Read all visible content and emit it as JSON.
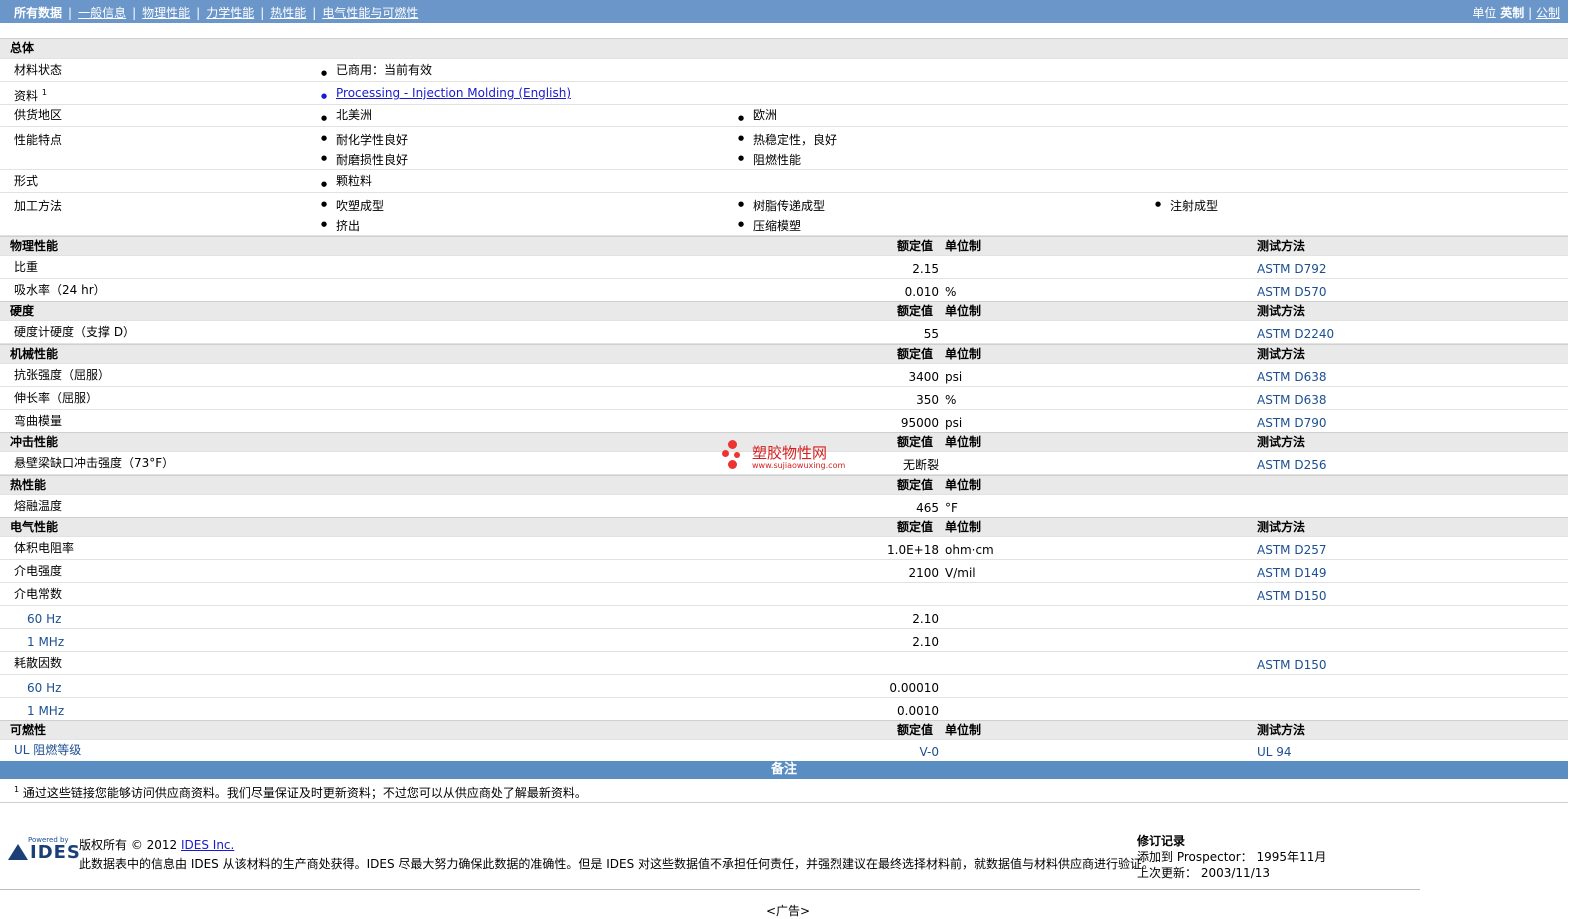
{
  "topnav": {
    "items": [
      "所有数据",
      "一般信息",
      "物理性能",
      "力学性能",
      "热性能",
      "电气性能与可燃性"
    ],
    "units_label": "单位",
    "unit_imperial": "英制",
    "unit_metric": "公制"
  },
  "general": {
    "title": "总体",
    "status_label": "材料状态",
    "status_value": "已商用：当前有效",
    "docs_label": "资料",
    "docs_sup": "1",
    "docs_link": "Processing - Injection Molding (English)",
    "region_label": "供货地区",
    "regions": [
      "北美洲",
      "欧洲"
    ],
    "features_label": "性能特点",
    "features": [
      "耐化学性良好",
      "热稳定性，良好",
      "耐磨损性良好",
      "阻燃性能"
    ],
    "form_label": "形式",
    "form_value": "颗粒料",
    "process_label": "加工方法",
    "processes": [
      "吹塑成型",
      "树脂传递成型",
      "注射成型",
      "挤出",
      "压缩模塑"
    ]
  },
  "headers": {
    "nominal": "额定值",
    "unit": "单位制",
    "test": "测试方法"
  },
  "physical": {
    "title": "物理性能",
    "rows": [
      {
        "label": "比重",
        "value": "2.15",
        "unit": "",
        "test": "ASTM D792"
      },
      {
        "label": "吸水率（24 hr）",
        "value": "0.010",
        "unit": "%",
        "test": "ASTM D570"
      }
    ]
  },
  "hardness": {
    "title": "硬度",
    "rows": [
      {
        "label": "硬度计硬度（支撑 D）",
        "value": "55",
        "unit": "",
        "test": "ASTM D2240"
      }
    ]
  },
  "mechanical": {
    "title": "机械性能",
    "rows": [
      {
        "label": "抗张强度（屈服）",
        "value": "3400",
        "unit": "psi",
        "test": "ASTM D638"
      },
      {
        "label": "伸长率（屈服）",
        "value": "350",
        "unit": "%",
        "test": "ASTM D638"
      },
      {
        "label": "弯曲模量",
        "value": "95000",
        "unit": "psi",
        "test": "ASTM D790"
      }
    ]
  },
  "impact": {
    "title": "冲击性能",
    "rows": [
      {
        "label": "悬壁梁缺口冲击强度（73°F）",
        "value": "无断裂",
        "unit": "",
        "test": "ASTM D256"
      }
    ]
  },
  "thermal": {
    "title": "热性能",
    "rows": [
      {
        "label": "熔融温度",
        "value": "465",
        "unit": "°F",
        "test": ""
      }
    ]
  },
  "electrical": {
    "title": "电气性能",
    "rows": [
      {
        "label": "体积电阻率",
        "value": "1.0E+18",
        "unit": "ohm·cm",
        "test": "ASTM D257"
      },
      {
        "label": "介电强度",
        "value": "2100",
        "unit": "V/mil",
        "test": "ASTM D149"
      },
      {
        "label": "介电常数",
        "value": "",
        "unit": "",
        "test": "ASTM D150"
      },
      {
        "label": "60 Hz",
        "value": "2.10",
        "unit": "",
        "test": ""
      },
      {
        "label": "1 MHz",
        "value": "2.10",
        "unit": "",
        "test": ""
      },
      {
        "label": "耗散因数",
        "value": "",
        "unit": "",
        "test": "ASTM D150"
      },
      {
        "label": "60 Hz",
        "value": "0.00010",
        "unit": "",
        "test": ""
      },
      {
        "label": "1 MHz",
        "value": "0.0010",
        "unit": "",
        "test": ""
      }
    ]
  },
  "flammability": {
    "title": "可燃性",
    "rows": [
      {
        "label": "UL 阻燃等级",
        "value": "V-0",
        "unit": "",
        "test": "UL 94"
      }
    ]
  },
  "notes": {
    "title": "备注",
    "footnote_sup": "1",
    "footnote": "通过这些链接您能够访问供应商资料。我们尽量保证及时更新资料；不过您可以从供应商处了解最新资料。"
  },
  "footer": {
    "logo_small": "Powered by",
    "logo_name": "IDES",
    "copyright_prefix": "版权所有 © 2012 ",
    "copyright_link": "IDES Inc.",
    "disclaimer": "此数据表中的信息由 IDES 从该材料的生产商处获得。IDES 尽最大努力确保此数据的准确性。但是 IDES 对这些数据值不承担任何责任，并强烈建议在最终选择材料前，就数据值与材料供应商进行验证。",
    "rev_title": "修订记录",
    "added_label": "添加到 Prospector：",
    "added_value": "1995年11月",
    "updated_label": "上次更新：",
    "updated_value": "2003/11/13",
    "ad": "<广告>"
  },
  "watermark": {
    "title": "塑胶物性网",
    "url": "www.sujiaowuxing.com"
  },
  "colors": {
    "topbar": "#6a96c9",
    "notes_bar": "#5a8dc2",
    "section_bg": "#e9e9e9",
    "watermark": "#d62020"
  }
}
